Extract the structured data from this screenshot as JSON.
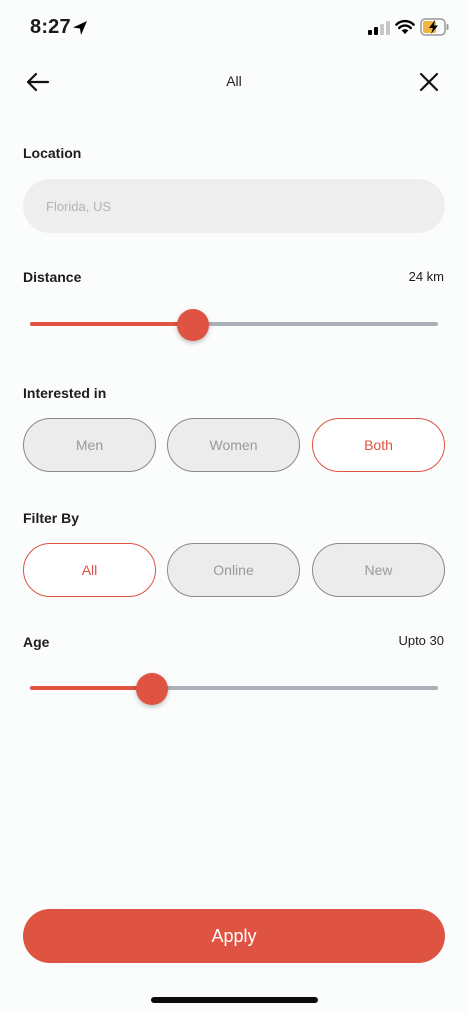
{
  "status_bar": {
    "time": "8:27"
  },
  "header": {
    "title": "All"
  },
  "location": {
    "label": "Location",
    "placeholder": "Florida, US"
  },
  "distance": {
    "label": "Distance",
    "value_text": "24 km",
    "fraction": 0.4
  },
  "interested_in": {
    "label": "Interested in",
    "options": [
      {
        "label": "Men",
        "selected": false
      },
      {
        "label": "Women",
        "selected": false
      },
      {
        "label": "Both",
        "selected": true
      }
    ]
  },
  "filter_by": {
    "label": "Filter By",
    "options": [
      {
        "label": "All",
        "selected": true
      },
      {
        "label": "Online",
        "selected": false
      },
      {
        "label": "New",
        "selected": false
      }
    ]
  },
  "age": {
    "label": "Age",
    "value_text": "Upto 30",
    "fraction": 0.3
  },
  "apply": {
    "label": "Apply"
  },
  "colors": {
    "accent": "#df5343",
    "track": "#aab0b7",
    "input_bg": "#eeeeee",
    "pill_bg": "#ececec"
  },
  "icons": [
    "location-arrow-icon",
    "signal-icon",
    "wifi-icon",
    "battery-charging-icon",
    "back-arrow-icon",
    "close-icon"
  ]
}
